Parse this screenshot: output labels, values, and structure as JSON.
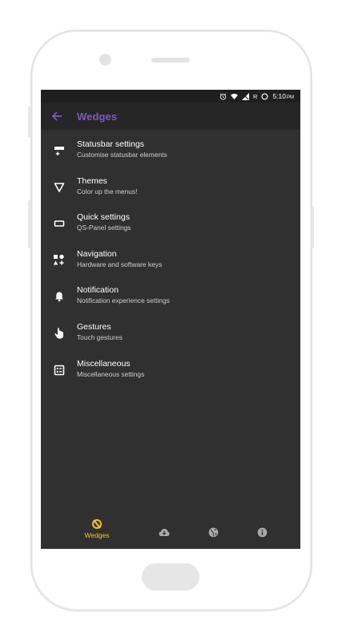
{
  "status_bar": {
    "time": "5:10",
    "ampm": "PM",
    "roaming": "R",
    "icons": [
      "alarm-icon",
      "wifi-icon",
      "signal-icon",
      "roaming-indicator",
      "battery-icon"
    ]
  },
  "app_bar": {
    "back_icon": "arrow-back-icon",
    "title": "Wedges",
    "accent_color": "#7e57c2"
  },
  "menu": {
    "items": [
      {
        "label": "Statusbar settings",
        "sub": "Customise statusbar elements",
        "icon": "statusbar-icon"
      },
      {
        "label": "Themes",
        "sub": "Color up the menus!",
        "icon": "triangle-icon"
      },
      {
        "label": "Quick settings",
        "sub": "QS-Panel settings",
        "icon": "panel-icon"
      },
      {
        "label": "Navigation",
        "sub": "Hardware and software keys",
        "icon": "shapes-icon"
      },
      {
        "label": "Notification",
        "sub": "Notification experience settings",
        "icon": "bell-icon"
      },
      {
        "label": "Gestures",
        "sub": "Touch gestures",
        "icon": "touch-icon"
      },
      {
        "label": "Miscellaneous",
        "sub": "Miscellaneous settings",
        "icon": "list-box-icon"
      }
    ]
  },
  "bottom_nav": {
    "active_color": "#f7c325",
    "items": [
      {
        "label": "Wedges",
        "icon": "wedges-icon",
        "active": true
      },
      {
        "label": "",
        "icon": "cloud-download-icon",
        "active": false
      },
      {
        "label": "",
        "icon": "globe-icon",
        "active": false
      },
      {
        "label": "",
        "icon": "info-icon",
        "active": false
      }
    ]
  },
  "colors": {
    "background": "#303030",
    "status_bar": "#1f1f1f",
    "app_bar": "#262626"
  }
}
